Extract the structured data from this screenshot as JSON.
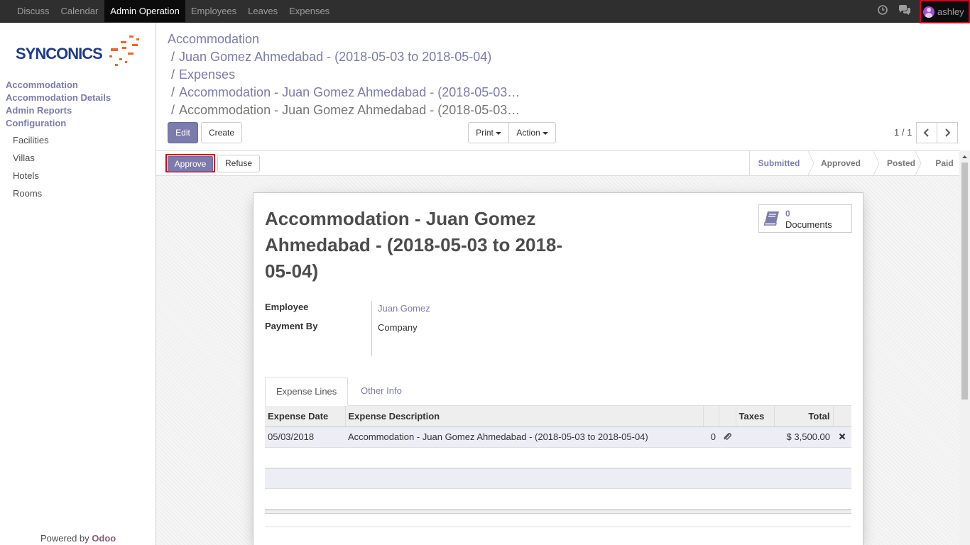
{
  "topbar": {
    "menu": [
      "Discuss",
      "Calendar",
      "Admin Operation",
      "Employees",
      "Leaves",
      "Expenses"
    ],
    "active_index": 2,
    "user": "ashley"
  },
  "sidebar": {
    "logo": "SYNCONICS",
    "sections": [
      "Accommodation",
      "Accommodation Details",
      "Admin Reports",
      "Configuration"
    ],
    "config_items": [
      "Facilities",
      "Villas",
      "Hotels",
      "Rooms"
    ],
    "powered_by": "Powered by",
    "powered_brand": "Odoo"
  },
  "breadcrumb": {
    "items": [
      "Accommodation",
      "Juan Gomez Ahmedabad - (2018-05-03 to 2018-05-04)",
      "Expenses",
      "Accommodation - Juan Gomez Ahmedabad - (2018-05-03…",
      "Accommodation - Juan Gomez Ahmedabad - (2018-05-03…"
    ],
    "separator": "/"
  },
  "buttons": {
    "edit": "Edit",
    "create": "Create",
    "print": "Print",
    "action": "Action",
    "approve": "Approve",
    "refuse": "Refuse"
  },
  "pager": {
    "value": "1 / 1"
  },
  "stages": [
    "Submitted",
    "Approved",
    "Posted",
    "Paid"
  ],
  "current_stage": "Submitted",
  "record": {
    "title": "Accommodation - Juan Gomez Ahmedabad - (2018-05-03 to 2018-05-04)",
    "documents_count": "0",
    "documents_label": "Documents",
    "employee_label": "Employee",
    "employee": "Juan Gomez",
    "payment_by_label": "Payment By",
    "payment_by": "Company"
  },
  "tabs": [
    "Expense Lines",
    "Other Info"
  ],
  "table": {
    "headers": [
      "Expense Date",
      "Expense Description",
      "",
      "",
      "Taxes",
      "Total",
      ""
    ],
    "rows": [
      {
        "date": "05/03/2018",
        "description": "Accommodation - Juan Gomez Ahmedabad - (2018-05-03 to 2018-05-04)",
        "attachments": "0",
        "taxes": "",
        "total": "$ 3,500.00"
      }
    ]
  },
  "colors": {
    "accent": "#7c7bad",
    "topbar": "#2f2f2f",
    "highlight": "#d9001b"
  }
}
